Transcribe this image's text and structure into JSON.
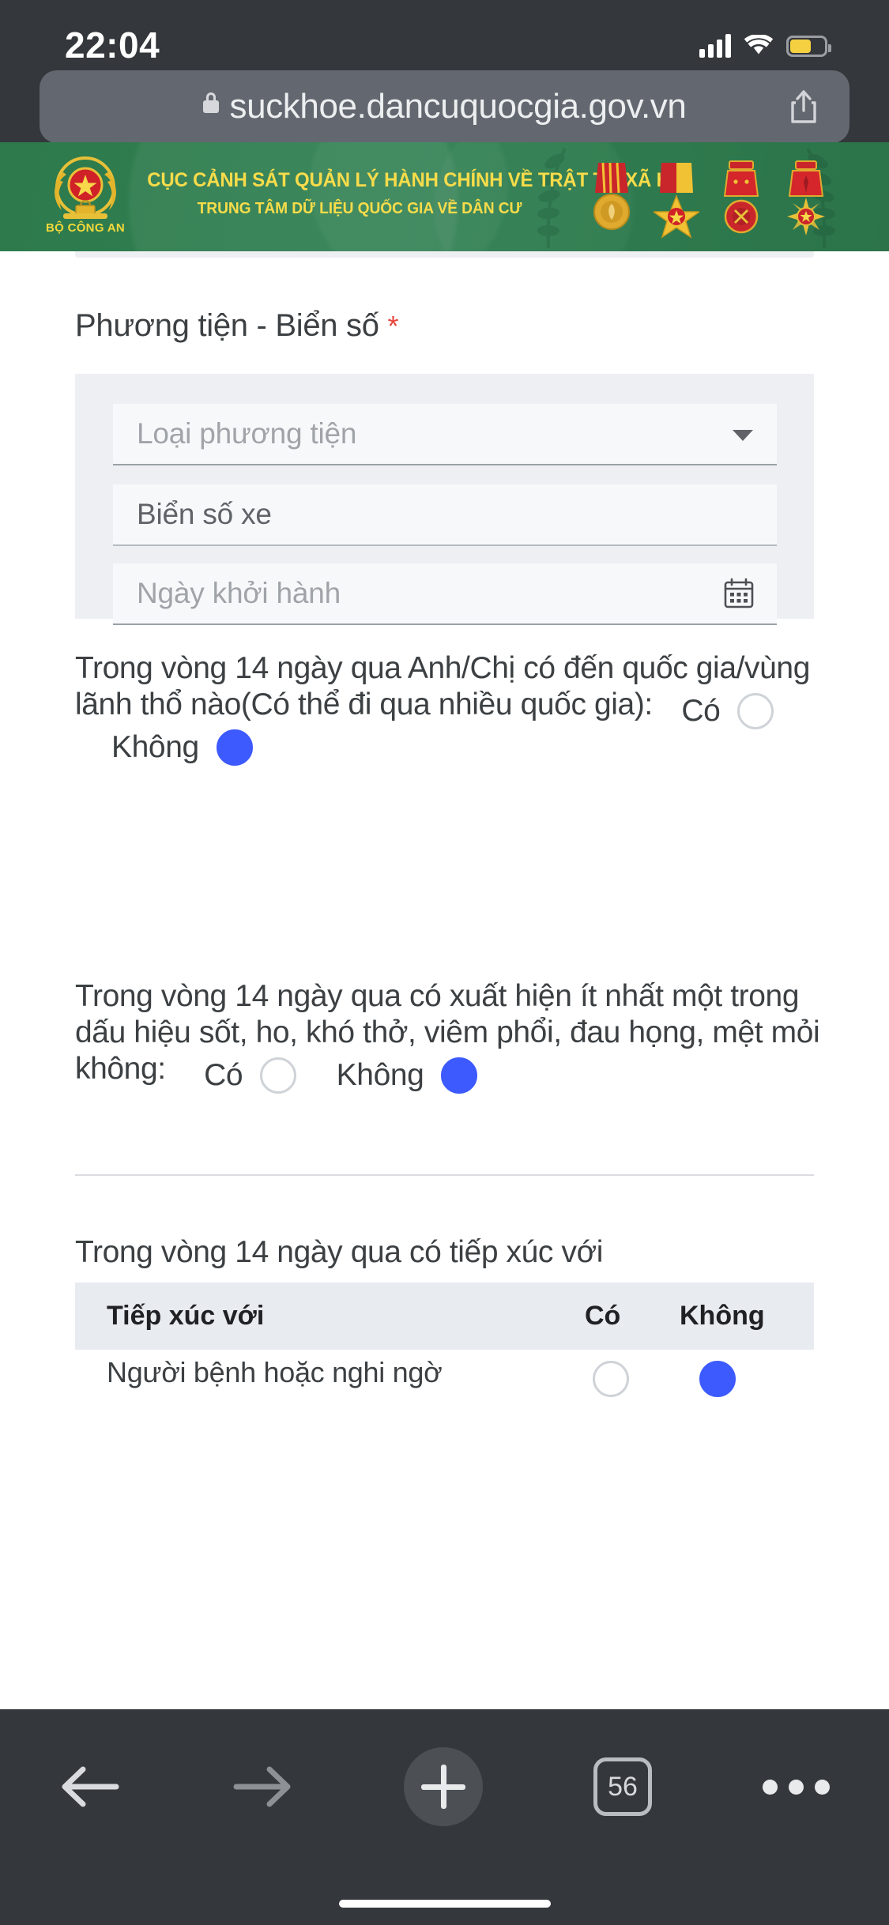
{
  "status_bar": {
    "time": "22:04",
    "signal_icon": "cellular-bars-icon",
    "wifi_icon": "wifi-icon",
    "battery_icon": "battery-low-power-icon"
  },
  "browser": {
    "url": "suckhoe.dancuquocgia.gov.vn",
    "lock_icon": "lock-icon",
    "share_icon": "share-icon"
  },
  "site_header": {
    "emblem_label": "BỘ CÔNG AN",
    "title_line1": "CỤC CẢNH SÁT QUẢN LÝ HÀNH CHÍNH VỀ TRẬT TỰ XÃ HỘI",
    "title_line2": "TRUNG TÂM DỮ LIỆU QUỐC GIA VỀ DÂN CƯ",
    "banner_color": "#2f7d4f",
    "title_color": "#f7dc4a",
    "medal_count": 4
  },
  "form": {
    "section_title": "Phương tiện - Biển số",
    "required_marker": "*",
    "vehicle_type_placeholder": "Loại phương tiện",
    "plate_placeholder": "Biển số xe",
    "departure_date_placeholder": "Ngày khởi hành",
    "dropdown_icon": "chevron-down-icon",
    "calendar_icon": "calendar-icon"
  },
  "questions": [
    {
      "text": "Trong vòng 14 ngày qua Anh/Chị có đến quốc gia/vùng lãnh thổ nào(Có thể đi qua nhiều quốc gia):",
      "yes_label": "Có",
      "no_label": "Không",
      "selected": "Không"
    },
    {
      "text": "Trong vòng 14 ngày qua có xuất hiện ít nhất một trong dấu hiệu sốt, ho, khó thở, viêm phổi, đau họng, mệt mỏi không:",
      "yes_label": "Có",
      "no_label": "Không",
      "selected": "Không"
    }
  ],
  "contact_section": {
    "intro": "Trong vòng 14 ngày qua có tiếp xúc với",
    "columns": [
      "Tiếp xúc với",
      "Có",
      "Không"
    ],
    "rows": [
      {
        "label": "Người bệnh hoặc nghi ngờ",
        "selected": "Không"
      }
    ]
  },
  "colors": {
    "radio_selected": "#3d5afe",
    "required_asterisk": "#e8453c",
    "field_bg": "#edeff3",
    "page_bg": "#ffffff"
  },
  "toolbar": {
    "back_icon": "arrow-back-icon",
    "forward_icon": "arrow-forward-icon",
    "new_tab_icon": "plus-icon",
    "tabs_count": "56",
    "more_icon": "more-dots-icon"
  }
}
